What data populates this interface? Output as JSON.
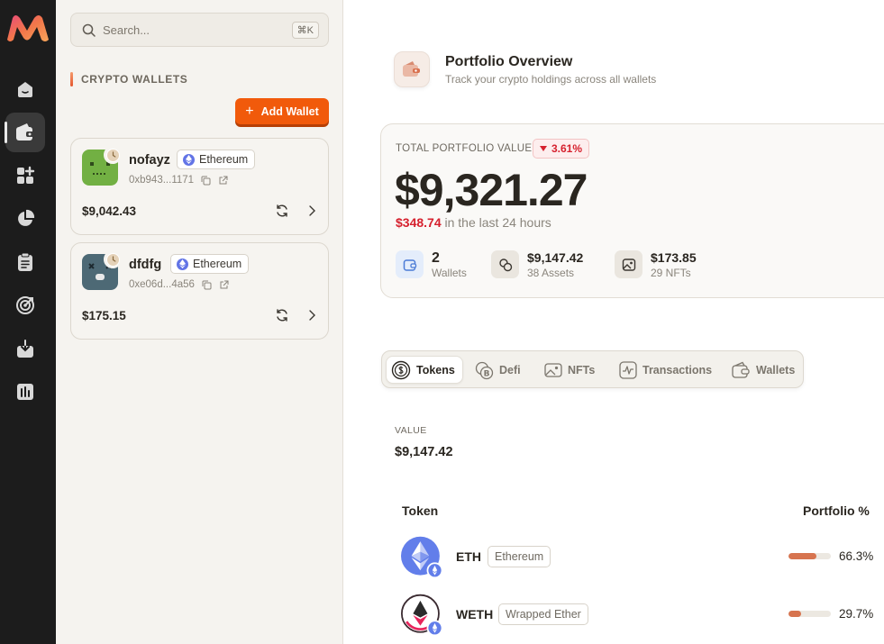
{
  "sidebar_rail": {
    "items": [
      {
        "icon": "home-icon"
      },
      {
        "icon": "wallet-icon",
        "active": true
      },
      {
        "icon": "apps-icon"
      },
      {
        "icon": "pie-chart-icon"
      },
      {
        "icon": "clipboard-icon"
      },
      {
        "icon": "target-icon"
      },
      {
        "icon": "download-icon"
      },
      {
        "icon": "bar-chart-icon"
      }
    ]
  },
  "search": {
    "placeholder": "Search...",
    "shortcut": "⌘K"
  },
  "wallets_section": {
    "title": "CRYPTO WALLETS",
    "add_button": "Add Wallet",
    "wallets": [
      {
        "name": "nofayz",
        "chain": "Ethereum",
        "address": "0xb943...1171",
        "balance": "$9,042.43",
        "avatar_color": "#72b043"
      },
      {
        "name": "dfdfg",
        "chain": "Ethereum",
        "address": "0xe06d...4a56",
        "balance": "$175.15",
        "avatar_color": "#4d6975"
      }
    ]
  },
  "header": {
    "title": "Portfolio Overview",
    "subtitle": "Track your crypto holdings across all wallets"
  },
  "overview": {
    "label": "TOTAL PORTFOLIO VALUE",
    "change_pct": "3.61%",
    "total": "$9,321.27",
    "delta_amount": "$348.74",
    "delta_text": " in the last 24 hours",
    "stats": {
      "wallets_count": "2",
      "wallets_label": "Wallets",
      "assets_value": "$9,147.42",
      "assets_label": "38 Assets",
      "nfts_value": "$173.85",
      "nfts_label": "29 NFTs"
    }
  },
  "tabs": [
    {
      "label": "Tokens",
      "active": true
    },
    {
      "label": "Defi"
    },
    {
      "label": "NFTs"
    },
    {
      "label": "Transactions"
    },
    {
      "label": "Wallets"
    }
  ],
  "tokens_view": {
    "value_label": "VALUE",
    "value_amount": "$9,147.42",
    "col_token": "Token",
    "col_portfolio": "Portfolio %",
    "rows": [
      {
        "symbol": "ETH",
        "name": "Ethereum",
        "pct": "66.3%",
        "pct_value": 0.663
      },
      {
        "symbol": "WETH",
        "name": "Wrapped Ether",
        "pct": "29.7%",
        "pct_value": 0.297
      }
    ]
  },
  "colors": {
    "accent": "#f15a0b",
    "negative": "#d6212e",
    "rail_bg": "#1c1c1c",
    "bar_fill": "#d7744f"
  }
}
